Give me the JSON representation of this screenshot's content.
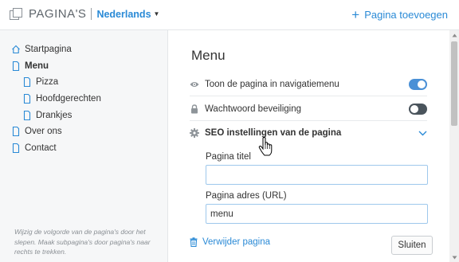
{
  "header": {
    "logo_text": "PAGINA'S",
    "language": "Nederlands",
    "add_page_label": "Pagina toevoegen",
    "accent_color": "#2a8ad6"
  },
  "sidebar": {
    "items": [
      {
        "label": "Startpagina",
        "icon": "home-icon",
        "level": 0,
        "active": false
      },
      {
        "label": "Menu",
        "icon": "page-icon",
        "level": 0,
        "active": true
      },
      {
        "label": "Pizza",
        "icon": "page-icon",
        "level": 1,
        "active": false
      },
      {
        "label": "Hoofdgerechten",
        "icon": "page-icon",
        "level": 1,
        "active": false
      },
      {
        "label": "Drankjes",
        "icon": "page-icon",
        "level": 1,
        "active": false
      },
      {
        "label": "Over ons",
        "icon": "page-icon",
        "level": 0,
        "active": false
      },
      {
        "label": "Contact",
        "icon": "page-icon",
        "level": 0,
        "active": false
      }
    ],
    "hint": "Wijzig de volgorde van de pagina's door het slepen. Maak subpagina's door pagina's naar rechts te trekken."
  },
  "panel": {
    "title": "Menu",
    "settings": {
      "show_in_nav": {
        "label": "Toon de pagina in navigatiemenu",
        "icon": "eye-icon",
        "enabled": true
      },
      "password": {
        "label": "Wachtwoord beveiliging",
        "icon": "lock-icon",
        "enabled": false
      },
      "seo": {
        "label": "SEO instellingen van de pagina",
        "icon": "gear-icon",
        "expanded": true
      }
    },
    "fields": {
      "page_title": {
        "label": "Pagina titel",
        "value": ""
      },
      "page_url": {
        "label": "Pagina adres (URL)",
        "value": "menu"
      }
    },
    "delete_label": "Verwijder pagina",
    "close_label": "Sluiten"
  },
  "colors": {
    "toggle_on": "#4a90d6",
    "toggle_off": "#4a545c",
    "sidebar_bg": "#f6f7f8"
  }
}
